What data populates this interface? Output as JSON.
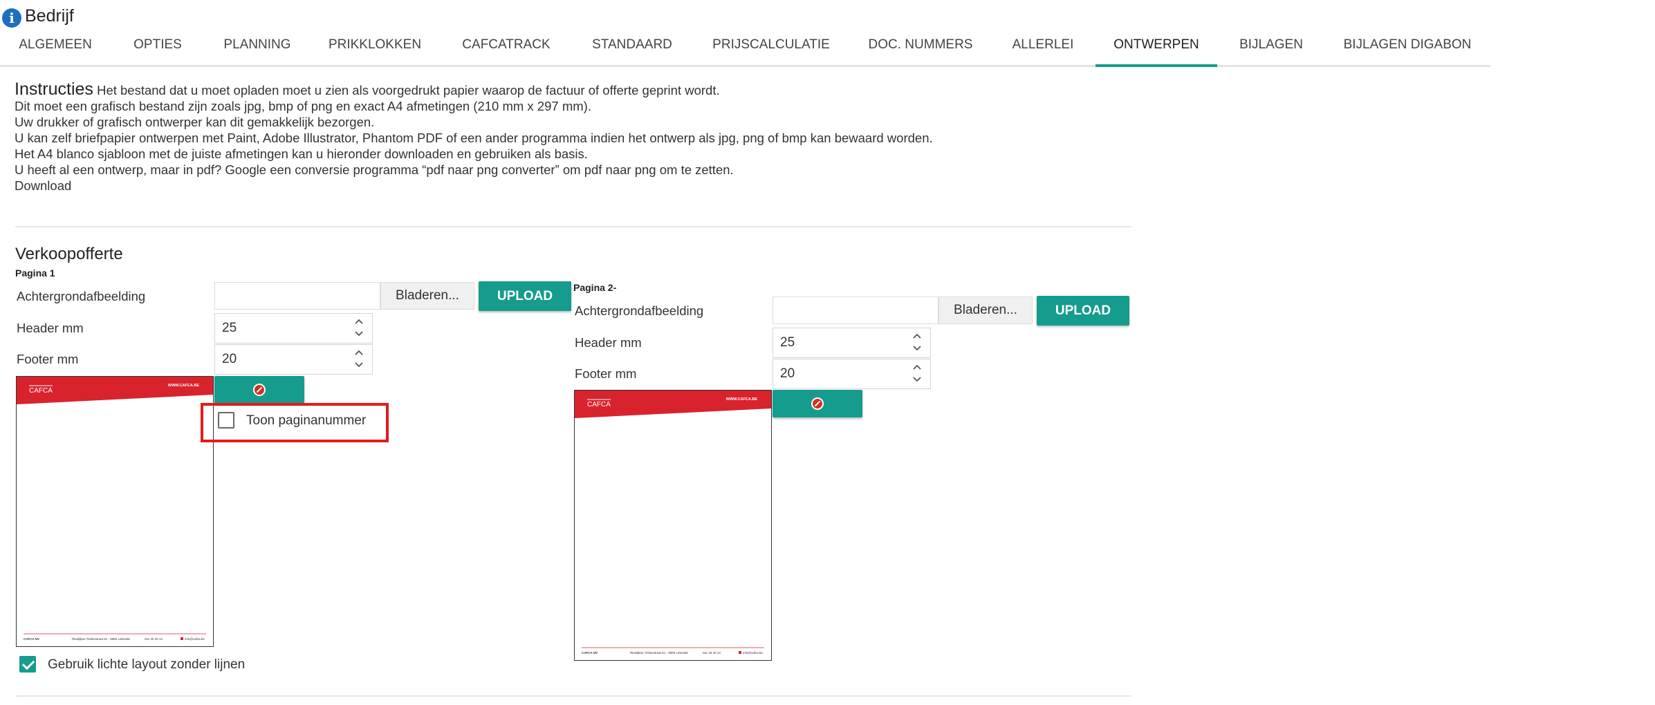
{
  "header": {
    "title": "Bedrijf",
    "icon": "info-icon"
  },
  "tabs": [
    {
      "label": "ALGEMEEN"
    },
    {
      "label": "OPTIES"
    },
    {
      "label": "PLANNING"
    },
    {
      "label": "PRIKKLOKKEN"
    },
    {
      "label": "CAFCATRACK"
    },
    {
      "label": "STANDAARD"
    },
    {
      "label": "PRIJSCALCULATIE"
    },
    {
      "label": "DOC. NUMMERS"
    },
    {
      "label": "ALLERLEI"
    },
    {
      "label": "ONTWERPEN"
    },
    {
      "label": "BIJLAGEN"
    },
    {
      "label": "BIJLAGEN DIGABON"
    }
  ],
  "active_tab": "ONTWERPEN",
  "instructions": {
    "heading": "Instructies",
    "line1": "Het bestand dat u moet opladen moet u zien als voorgedrukt papier waarop de factuur of offerte geprint wordt.",
    "line2": "Dit moet een grafisch bestand zijn zoals jpg, bmp of png en exact A4 afmetingen (210 mm x 297 mm).",
    "line3": "Uw drukker of grafisch ontwerper kan dit gemakkelijk bezorgen.",
    "line4": "U kan zelf briefpapier ontwerpen met Paint, Adobe Illustrator, Phantom PDF of een ander programma indien het ontwerp als jpg, png of bmp kan bewaard worden.",
    "line5": "Het A4 blanco sjabloon met de juiste afmetingen kan u hieronder downloaden en gebruiken als basis.",
    "line6": "U heeft al een ontwerp, maar in pdf? Google een conversie programma “pdf naar png converter” om pdf naar png om te zetten.",
    "download": "Download"
  },
  "section": {
    "title": "Verkoopofferte",
    "page1": {
      "label": "Pagina 1",
      "background_label": "Achtergrondafbeelding",
      "browse_label": "Bladeren...",
      "upload_label": "UPLOAD",
      "header_label": "Header mm",
      "header_value": "25",
      "footer_label": "Footer mm",
      "footer_value": "20",
      "show_page_number_label": "Toon paginanummer",
      "show_page_number_checked": false,
      "light_layout_label": "Gebruik lichte layout zonder lijnen",
      "light_layout_checked": true
    },
    "page2": {
      "label": "Pagina 2-",
      "background_label": "Achtergrondafbeelding",
      "browse_label": "Bladeren...",
      "upload_label": "UPLOAD",
      "header_label": "Header mm",
      "header_value": "25",
      "footer_label": "Footer mm",
      "footer_value": "20"
    }
  },
  "preview": {
    "logo": "CAFCA",
    "website": "WWW.CAFCA.BE",
    "footer_company": "CAFCA NV",
    "footer_address": "Rietdijkse Tieltsestraat 51 - 8980 Lelendal",
    "footer_phone": "011 30 40 12",
    "footer_email": "info@cafca.be"
  },
  "colors": {
    "accent": "#159c8c",
    "brand_red": "#d8232d",
    "highlight": "#e31b1b"
  }
}
